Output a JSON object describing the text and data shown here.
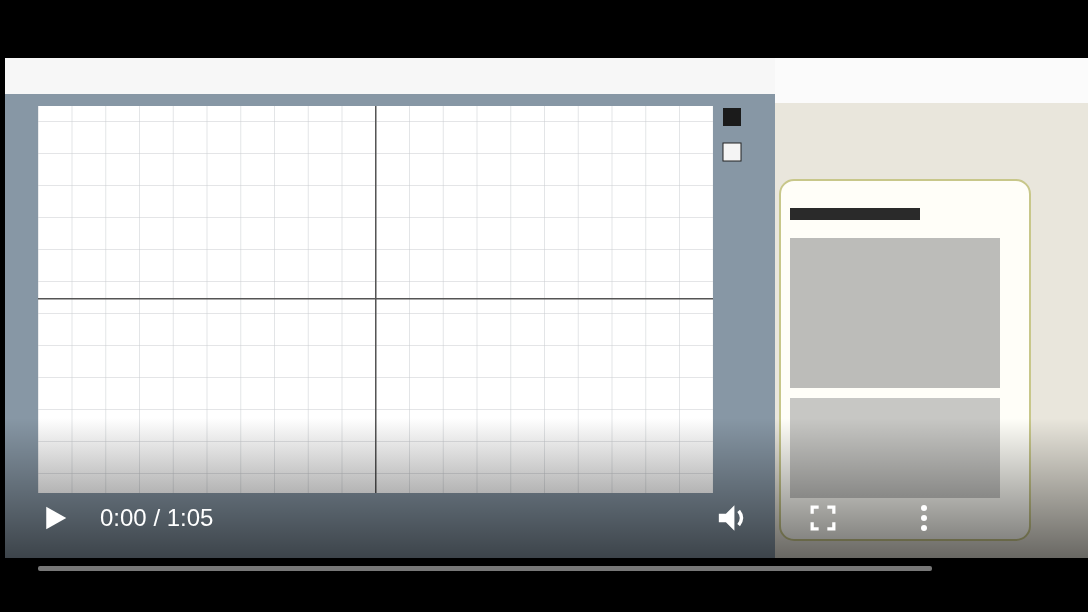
{
  "player": {
    "playing": false,
    "time": "0:00 / 1:05",
    "progress": {
      "level": 0
    }
  }
}
